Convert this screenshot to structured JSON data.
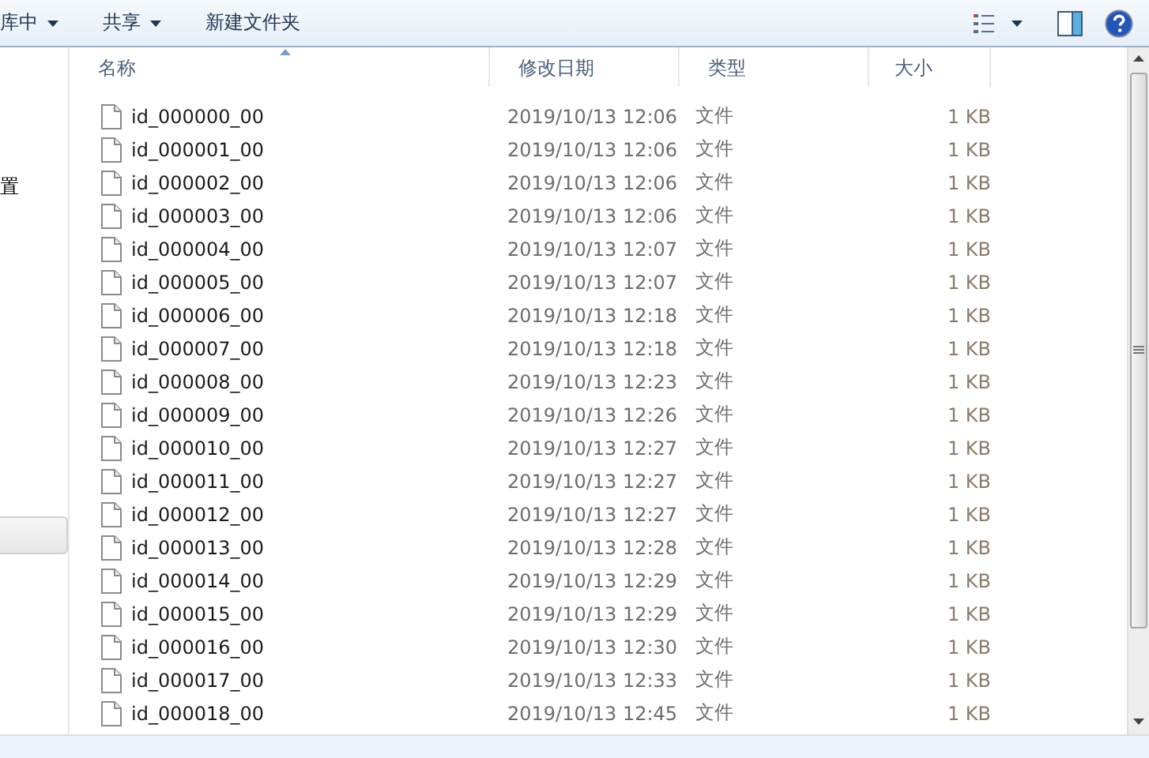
{
  "toolbar": {
    "buttons": [
      {
        "label": "库中",
        "dropdown": true
      },
      {
        "label": "共享",
        "dropdown": true
      },
      {
        "label": "新建文件夹",
        "dropdown": false
      }
    ]
  },
  "nav_pane": {
    "items": [
      {
        "label": "置",
        "selected": false
      },
      {
        "selected": true
      }
    ]
  },
  "table": {
    "columns": [
      {
        "label": "名称",
        "sorted": true
      },
      {
        "label": "修改日期",
        "sorted": false
      },
      {
        "label": "类型",
        "sorted": false
      },
      {
        "label": "大小",
        "sorted": false
      }
    ],
    "rows": [
      {
        "name": "id_000000_00",
        "modified": "2019/10/13 12:06",
        "type": "文件",
        "size": "1 KB"
      },
      {
        "name": "id_000001_00",
        "modified": "2019/10/13 12:06",
        "type": "文件",
        "size": "1 KB"
      },
      {
        "name": "id_000002_00",
        "modified": "2019/10/13 12:06",
        "type": "文件",
        "size": "1 KB"
      },
      {
        "name": "id_000003_00",
        "modified": "2019/10/13 12:06",
        "type": "文件",
        "size": "1 KB"
      },
      {
        "name": "id_000004_00",
        "modified": "2019/10/13 12:07",
        "type": "文件",
        "size": "1 KB"
      },
      {
        "name": "id_000005_00",
        "modified": "2019/10/13 12:07",
        "type": "文件",
        "size": "1 KB"
      },
      {
        "name": "id_000006_00",
        "modified": "2019/10/13 12:18",
        "type": "文件",
        "size": "1 KB"
      },
      {
        "name": "id_000007_00",
        "modified": "2019/10/13 12:18",
        "type": "文件",
        "size": "1 KB"
      },
      {
        "name": "id_000008_00",
        "modified": "2019/10/13 12:23",
        "type": "文件",
        "size": "1 KB"
      },
      {
        "name": "id_000009_00",
        "modified": "2019/10/13 12:26",
        "type": "文件",
        "size": "1 KB"
      },
      {
        "name": "id_000010_00",
        "modified": "2019/10/13 12:27",
        "type": "文件",
        "size": "1 KB"
      },
      {
        "name": "id_000011_00",
        "modified": "2019/10/13 12:27",
        "type": "文件",
        "size": "1 KB"
      },
      {
        "name": "id_000012_00",
        "modified": "2019/10/13 12:27",
        "type": "文件",
        "size": "1 KB"
      },
      {
        "name": "id_000013_00",
        "modified": "2019/10/13 12:28",
        "type": "文件",
        "size": "1 KB"
      },
      {
        "name": "id_000014_00",
        "modified": "2019/10/13 12:29",
        "type": "文件",
        "size": "1 KB"
      },
      {
        "name": "id_000015_00",
        "modified": "2019/10/13 12:29",
        "type": "文件",
        "size": "1 KB"
      },
      {
        "name": "id_000016_00",
        "modified": "2019/10/13 12:30",
        "type": "文件",
        "size": "1 KB"
      },
      {
        "name": "id_000017_00",
        "modified": "2019/10/13 12:33",
        "type": "文件",
        "size": "1 KB"
      },
      {
        "name": "id_000018_00",
        "modified": "2019/10/13 12:45",
        "type": "文件",
        "size": "1 KB"
      }
    ]
  }
}
